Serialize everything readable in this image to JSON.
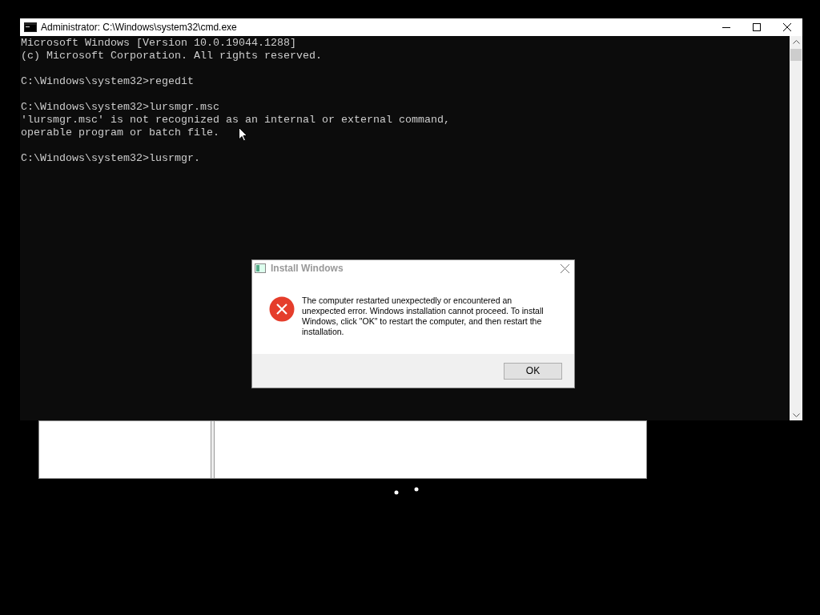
{
  "console_window": {
    "title": "Administrator: C:\\Windows\\system32\\cmd.exe",
    "blocks": [
      [
        "Microsoft Windows [Version 10.0.19044.1288]",
        "(c) Microsoft Corporation. All rights reserved."
      ],
      [
        "C:\\Windows\\system32>regedit"
      ],
      [
        "C:\\Windows\\system32>lursmgr.msc",
        "'lursmgr.msc' is not recognized as an internal or external command,",
        "operable program or batch file."
      ],
      [
        "C:\\Windows\\system32>lusrmgr."
      ]
    ]
  },
  "dialog": {
    "title": "Install Windows",
    "message": "The computer restarted unexpectedly or encountered an unexpected error. Windows installation cannot proceed. To install Windows, click \"OK\" to restart the computer, and then restart the installation.",
    "buttons": [
      "OK"
    ]
  }
}
